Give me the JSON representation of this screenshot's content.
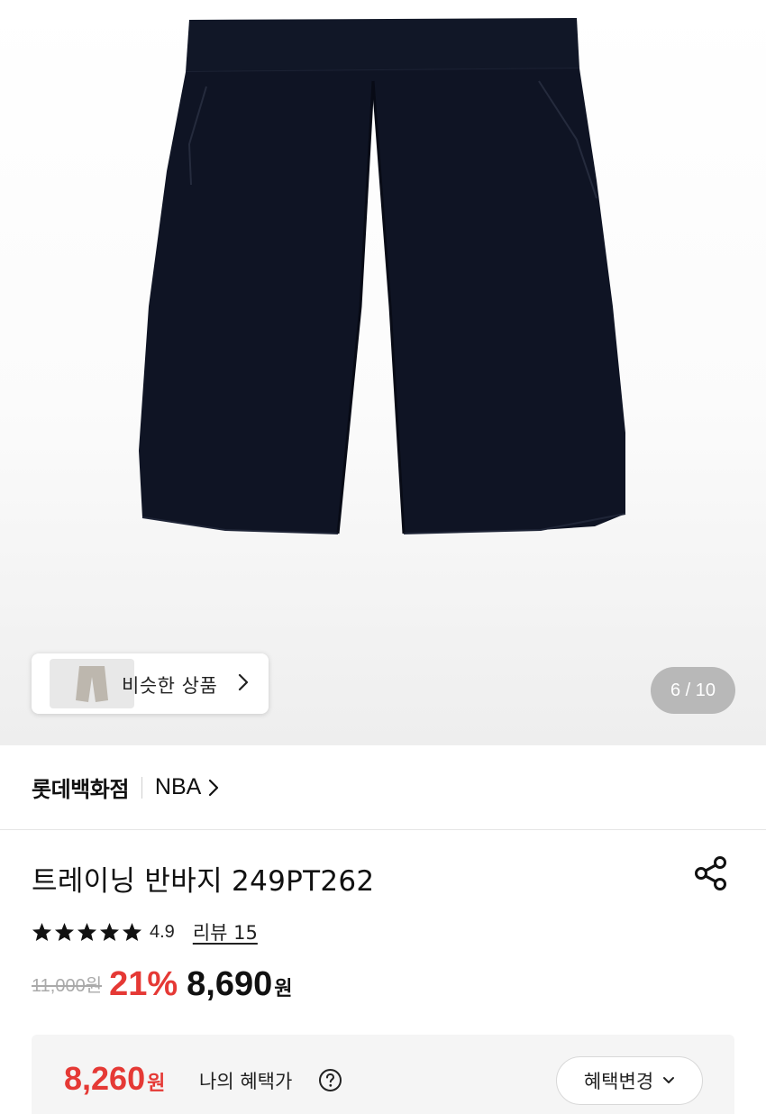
{
  "gallery": {
    "page_indicator": "6 / 10",
    "similar_products_label": "비슷한 상품",
    "current_page": 6,
    "total_pages": 10
  },
  "store": {
    "name": "롯데백화점",
    "brand": "NBA"
  },
  "product": {
    "title": "트레이닝 반바지 249PT262",
    "rating": "4.9",
    "rating_stars": 5,
    "review_label": "리뷰 15",
    "original_price": "11,000원",
    "discount_rate": "21%",
    "sale_price": "8,690",
    "sale_unit": "원"
  },
  "benefit": {
    "price": "8,260",
    "unit": "원",
    "label": "나의 혜택가",
    "change_button": "혜택변경"
  },
  "colors": {
    "accent_red": "#e53935",
    "shorts_navy": "#0f1424",
    "indicator_bg": "#b8b8b8"
  },
  "icons": {
    "share": "share-icon",
    "star": "star-icon",
    "help": "question-circle-icon",
    "chevron_right": "chevron-right-icon",
    "chevron_down": "chevron-down-icon"
  }
}
